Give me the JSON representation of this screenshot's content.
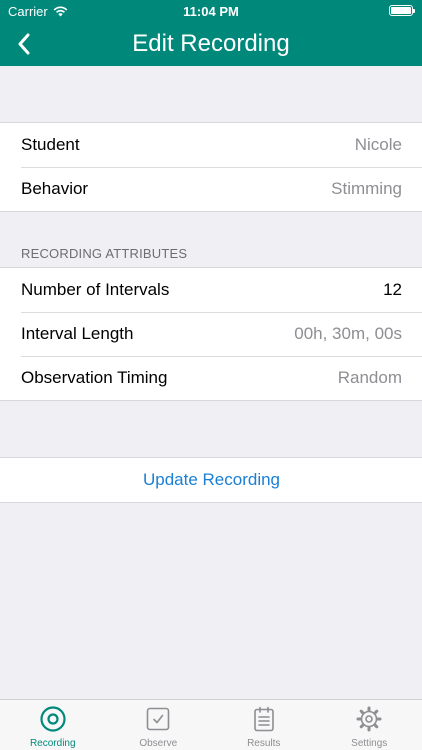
{
  "status_bar": {
    "carrier": "Carrier",
    "time": "11:04 PM"
  },
  "nav": {
    "title": "Edit Recording"
  },
  "basic": {
    "student_label": "Student",
    "student_value": "Nicole",
    "behavior_label": "Behavior",
    "behavior_value": "Stimming"
  },
  "attributes": {
    "header": "RECORDING ATTRIBUTES",
    "intervals_label": "Number of Intervals",
    "intervals_value": "12",
    "length_label": "Interval Length",
    "length_value": "00h, 30m, 00s",
    "timing_label": "Observation Timing",
    "timing_value": "Random"
  },
  "actions": {
    "update_label": "Update Recording"
  },
  "tabs": [
    {
      "label": "Recording",
      "icon": "target-icon"
    },
    {
      "label": "Observe",
      "icon": "checkbox-icon"
    },
    {
      "label": "Results",
      "icon": "clipboard-icon"
    },
    {
      "label": "Settings",
      "icon": "gear-icon"
    }
  ],
  "colors": {
    "accent": "#00897b",
    "link": "#1a7fd4"
  }
}
